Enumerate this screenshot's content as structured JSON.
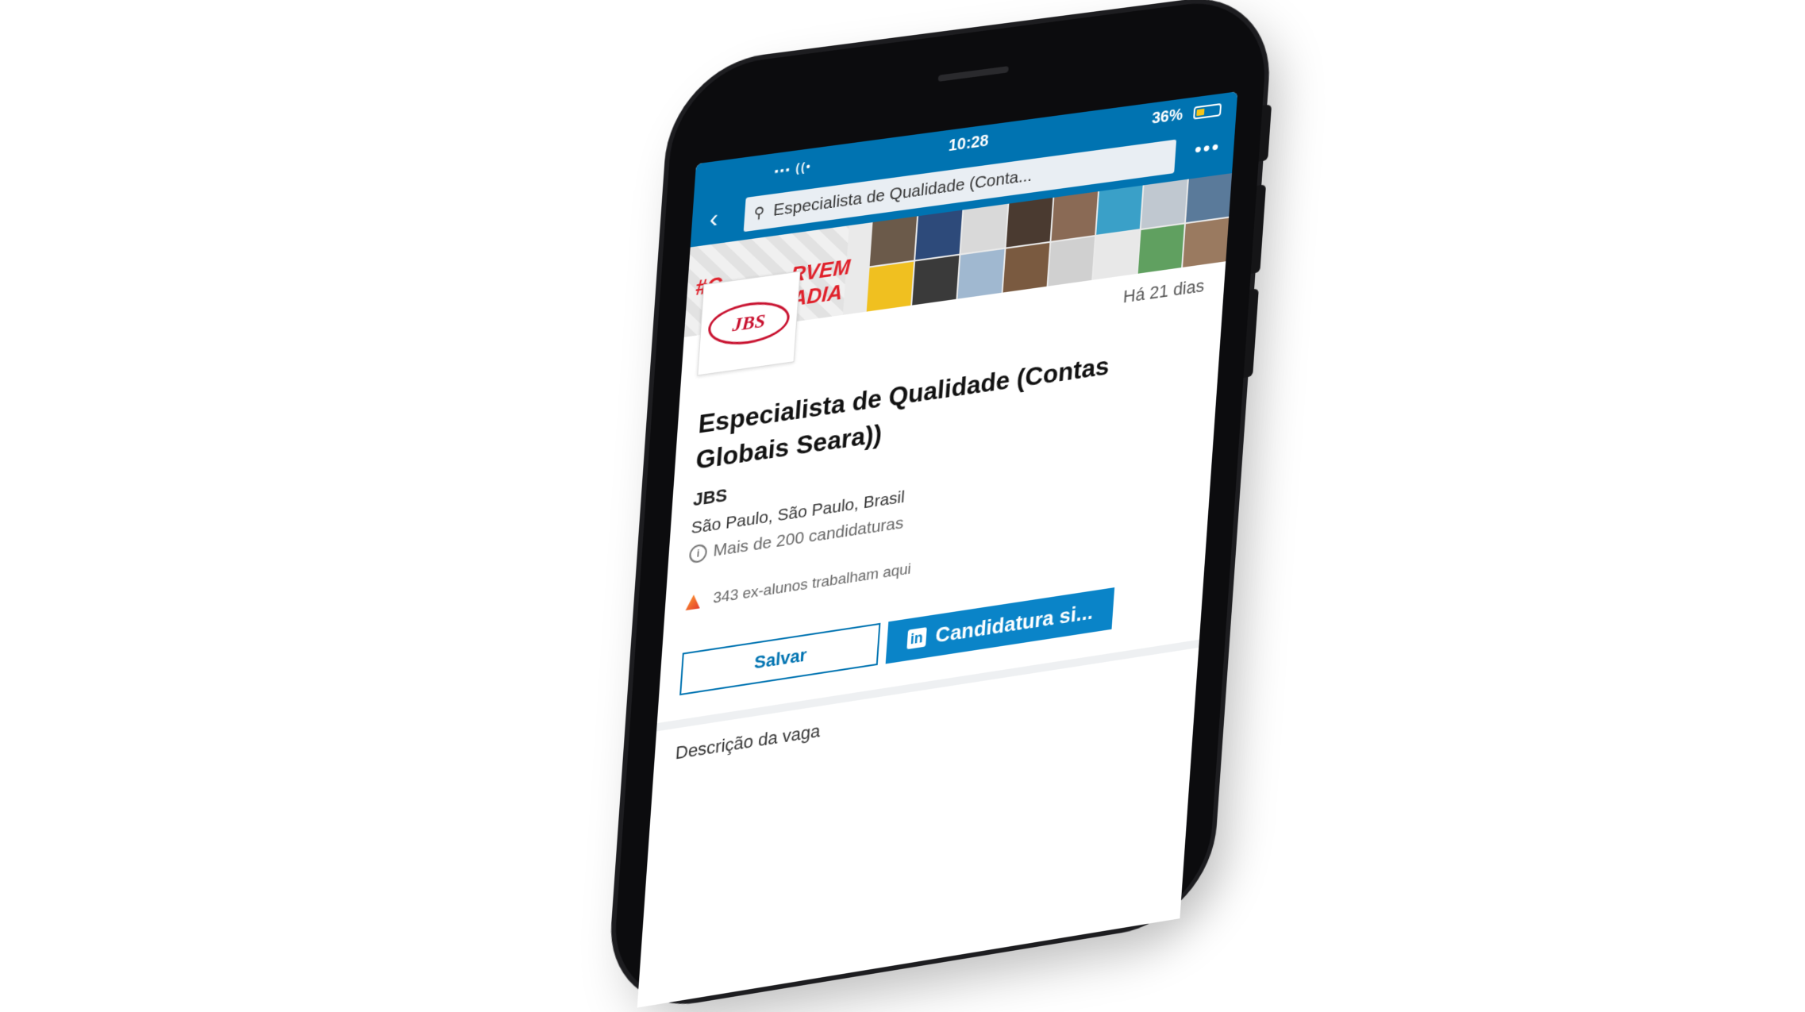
{
  "status_bar": {
    "time": "10:28",
    "battery": "36%",
    "battery_level": 0.36
  },
  "search": {
    "query": "Especialista de Qualidade (Conta..."
  },
  "banner": {
    "tag_line1": "#C",
    "tag_line1b": "RVEM",
    "tag_line2": "DADIA"
  },
  "company_logo": {
    "text": "JBS"
  },
  "job": {
    "posted": "Há 21 dias",
    "title": "Especialista de Qualidade (Contas Globais Seara))",
    "company": "JBS",
    "location": "São Paulo, São Paulo, Brasil",
    "applicants": "Mais de 200 candidaturas",
    "alumni": "343 ex-alunos trabalham aqui"
  },
  "actions": {
    "save_label": "Salvar",
    "apply_label": "Candidatura si..."
  },
  "section": {
    "description_label": "Descrição da vaga"
  },
  "colors": {
    "brand_blue": "#0073b1",
    "apply_blue": "#0a84c8",
    "jbs_red": "#c8102e"
  },
  "icons": [
    "back-icon",
    "search-icon",
    "more-icon",
    "wifi-icon",
    "battery-icon",
    "info-icon",
    "linkedin-icon",
    "school-icon"
  ]
}
